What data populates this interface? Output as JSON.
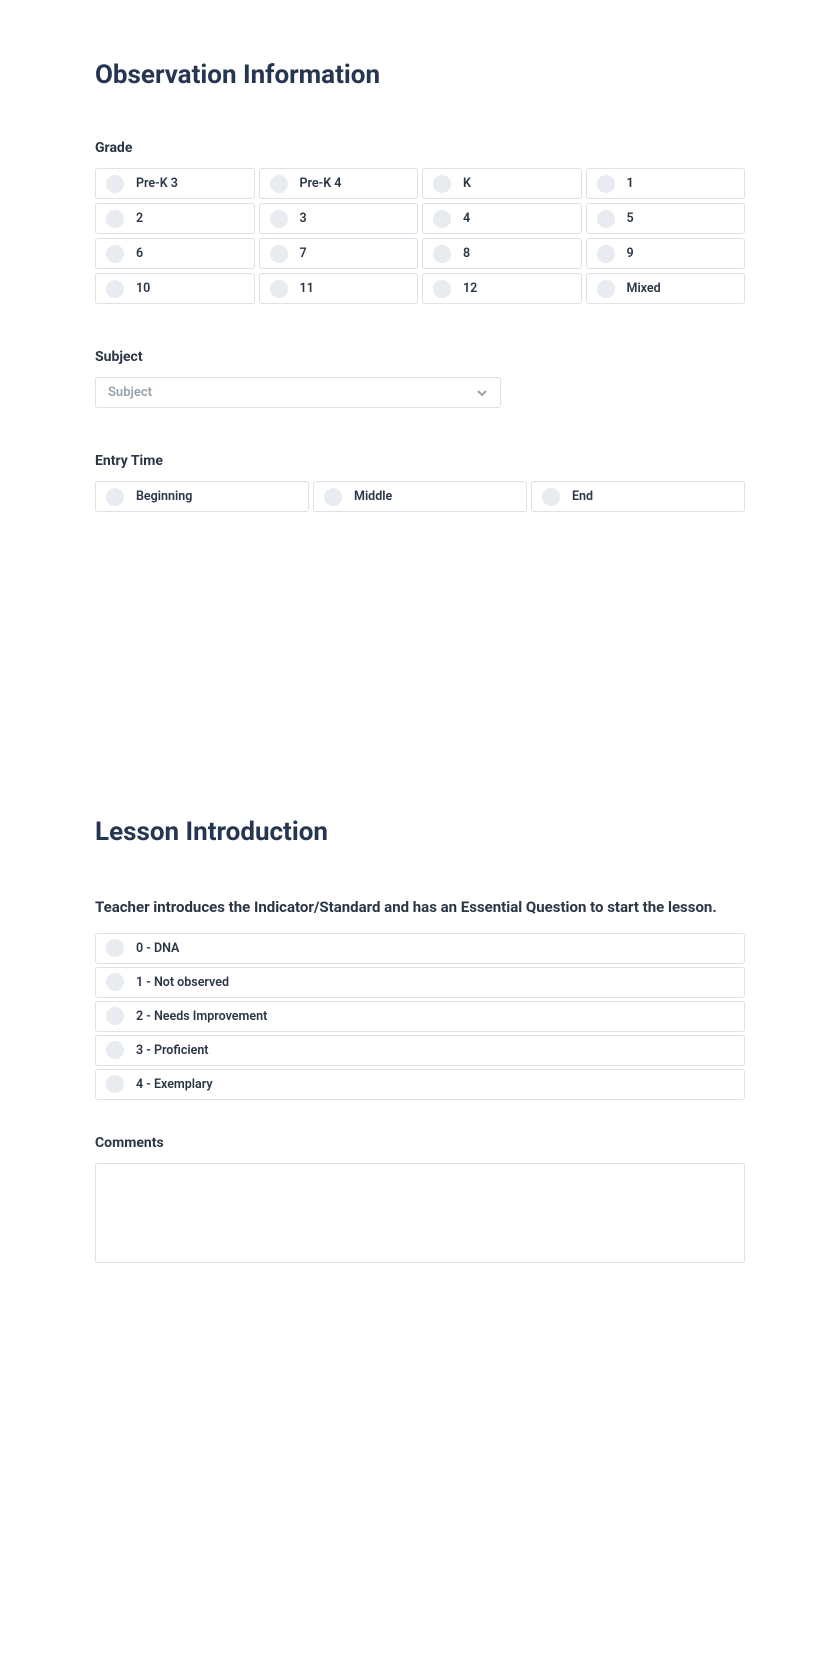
{
  "section1": {
    "title": "Observation Information",
    "grade": {
      "label": "Grade",
      "options": [
        "Pre-K 3",
        "Pre-K 4",
        "K",
        "1",
        "2",
        "3",
        "4",
        "5",
        "6",
        "7",
        "8",
        "9",
        "10",
        "11",
        "12",
        "Mixed"
      ]
    },
    "subject": {
      "label": "Subject",
      "placeholder": "Subject"
    },
    "entryTime": {
      "label": "Entry Time",
      "options": [
        "Beginning",
        "Middle",
        "End"
      ]
    }
  },
  "section2": {
    "title": "Lesson Introduction",
    "question1": {
      "label": "Teacher introduces the Indicator/Standard and has an Essential Question to start the lesson.",
      "options": [
        "0 - DNA",
        "1 - Not observed",
        "2 - Needs Improvement",
        "3 - Proficient",
        "4 - Exemplary"
      ]
    },
    "comments": {
      "label": "Comments"
    }
  }
}
